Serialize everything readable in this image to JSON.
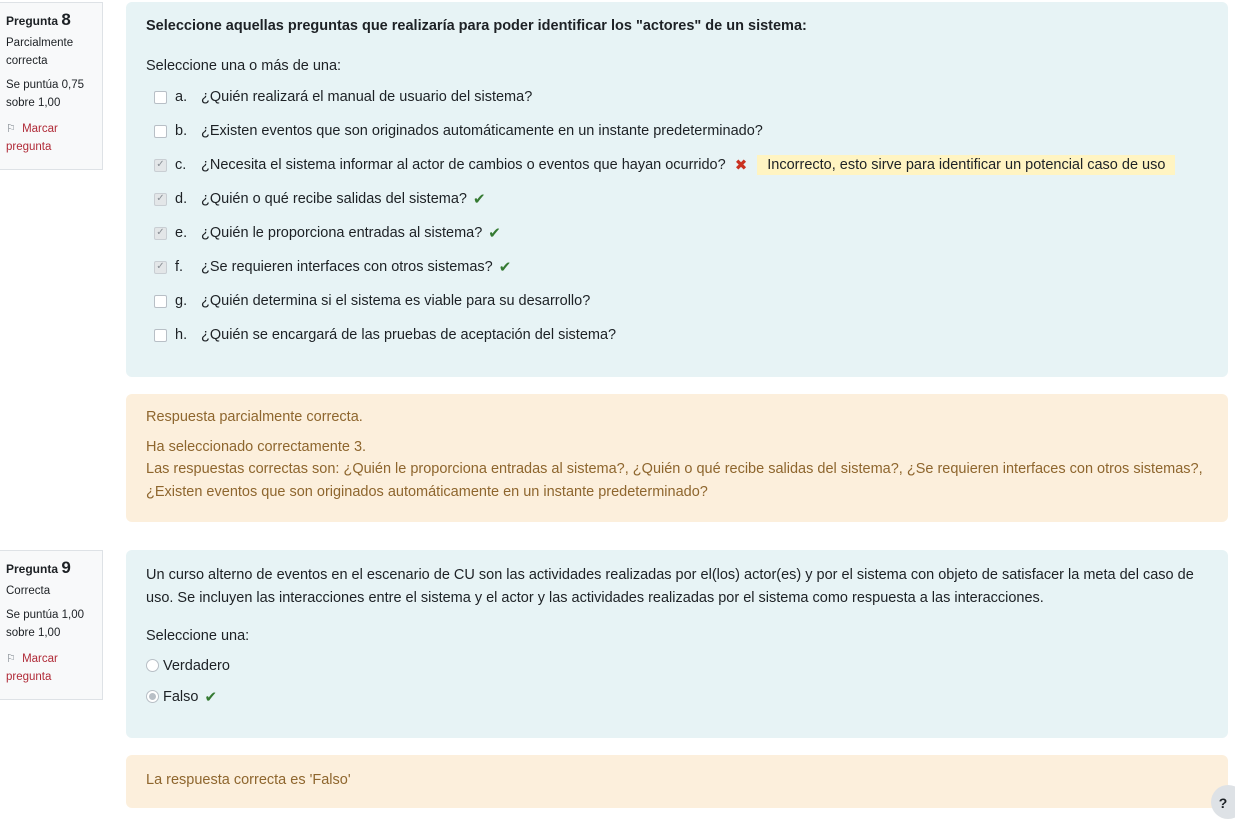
{
  "q8": {
    "info": {
      "label": "Pregunta",
      "number": "8",
      "state": "Parcialmente correcta",
      "grade": "Se puntúa 0,75 sobre 1,00",
      "flag": "Marcar pregunta"
    },
    "question": "Seleccione aquellas preguntas que realizaría para poder identificar los \"actores\" de un sistema:",
    "prompt": "Seleccione una o más de una:",
    "options": [
      {
        "letter": "a.",
        "text": "¿Quién realizará el manual de usuario del sistema?",
        "checked": false
      },
      {
        "letter": "b.",
        "text": "¿Existen eventos que son originados automáticamente en un instante predeterminado?",
        "checked": false
      },
      {
        "letter": "c.",
        "text": "¿Necesita el sistema informar al actor de cambios o eventos que hayan ocurrido?",
        "checked": true,
        "mark": "incorrect",
        "feedback": "Incorrecto, esto sirve para identificar un potencial caso de uso"
      },
      {
        "letter": "d.",
        "text": "¿Quién o qué recibe salidas del sistema?",
        "checked": true,
        "mark": "correct"
      },
      {
        "letter": "e.",
        "text": "¿Quién le proporciona entradas al sistema?",
        "checked": true,
        "mark": "correct"
      },
      {
        "letter": "f.",
        "text": "¿Se requieren interfaces con otros sistemas?",
        "checked": true,
        "mark": "correct"
      },
      {
        "letter": "g.",
        "text": "¿Quién determina si el sistema es viable para su desarrollo?",
        "checked": false
      },
      {
        "letter": "h.",
        "text": "¿Quién se encargará de las pruebas de aceptación del sistema?",
        "checked": false
      }
    ],
    "outcome": {
      "summary": "Respuesta parcialmente correcta.",
      "count": "Ha seleccionado correctamente 3.",
      "right_answer": "Las respuestas correctas son: ¿Quién le proporciona entradas al sistema?, ¿Quién o qué recibe salidas del sistema?, ¿Se requieren interfaces con otros sistemas?, ¿Existen eventos que son originados automáticamente en un instante predeterminado?"
    }
  },
  "q9": {
    "info": {
      "label": "Pregunta",
      "number": "9",
      "state": "Correcta",
      "grade": "Se puntúa 1,00 sobre 1,00",
      "flag": "Marcar pregunta"
    },
    "question": "Un curso alterno de eventos en el escenario de CU son  las actividades realizadas por el(los) actor(es) y por el sistema con objeto de satisfacer la meta del caso de uso. Se incluyen las interacciones entre el sistema y el actor y las actividades realizadas por el sistema como respuesta a las interacciones.",
    "prompt": "Seleccione una:",
    "options": [
      {
        "text": "Verdadero",
        "checked": false
      },
      {
        "text": "Falso",
        "checked": true,
        "mark": "correct"
      }
    ],
    "outcome": {
      "right_answer": "La respuesta correcta es 'Falso'"
    }
  },
  "icons": {
    "correct": "✔",
    "incorrect": "✖",
    "check": "✓",
    "flag": "⚐",
    "help": "?"
  },
  "colors": {
    "formulation_bg": "#e7f3f5",
    "outcome_bg": "#fcefdc",
    "outcome_text": "#8e662e",
    "correct": "#357a32",
    "incorrect": "#ca3120",
    "feedback_bg": "#fff4c2",
    "flag_text": "#b02a37"
  }
}
